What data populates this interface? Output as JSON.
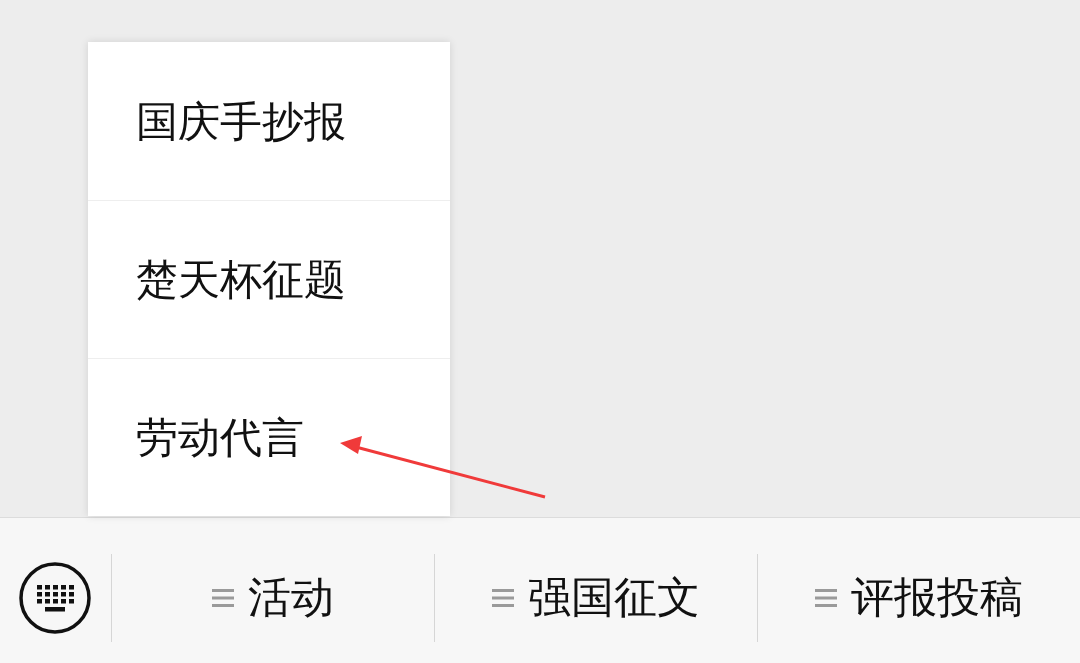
{
  "popup_menu": {
    "items": [
      {
        "label": "国庆手抄报"
      },
      {
        "label": "楚天杯征题"
      },
      {
        "label": "劳动代言"
      }
    ]
  },
  "bottom_menu": {
    "items": [
      {
        "label": "活动"
      },
      {
        "label": "强国征文"
      },
      {
        "label": "评报投稿"
      }
    ]
  }
}
